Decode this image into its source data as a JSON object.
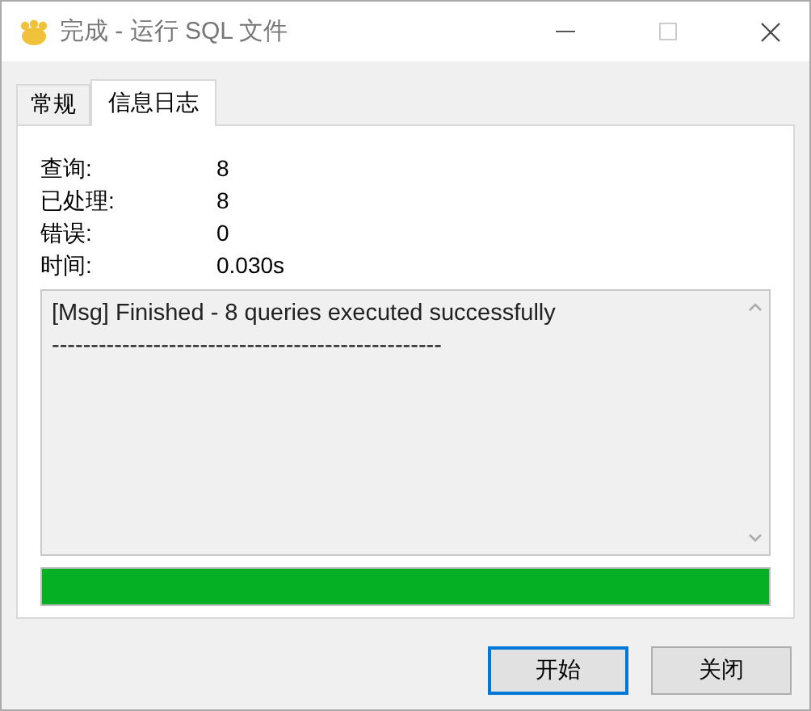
{
  "window": {
    "title": "完成 - 运行 SQL 文件"
  },
  "tabs": [
    {
      "label": "常规",
      "selected": false
    },
    {
      "label": "信息日志",
      "selected": true
    }
  ],
  "stats": [
    {
      "label": "查询:",
      "value": "8"
    },
    {
      "label": "已处理:",
      "value": "8"
    },
    {
      "label": "错误:",
      "value": "0"
    },
    {
      "label": "时间:",
      "value": "0.030s"
    }
  ],
  "log": {
    "lines": [
      "[Msg] Finished - 8 queries executed successfully",
      "--------------------------------------------------"
    ]
  },
  "progress": {
    "level": 1
  },
  "buttons": [
    {
      "label": "开始",
      "focused": true
    },
    {
      "label": "关闭",
      "focused": false
    }
  ]
}
